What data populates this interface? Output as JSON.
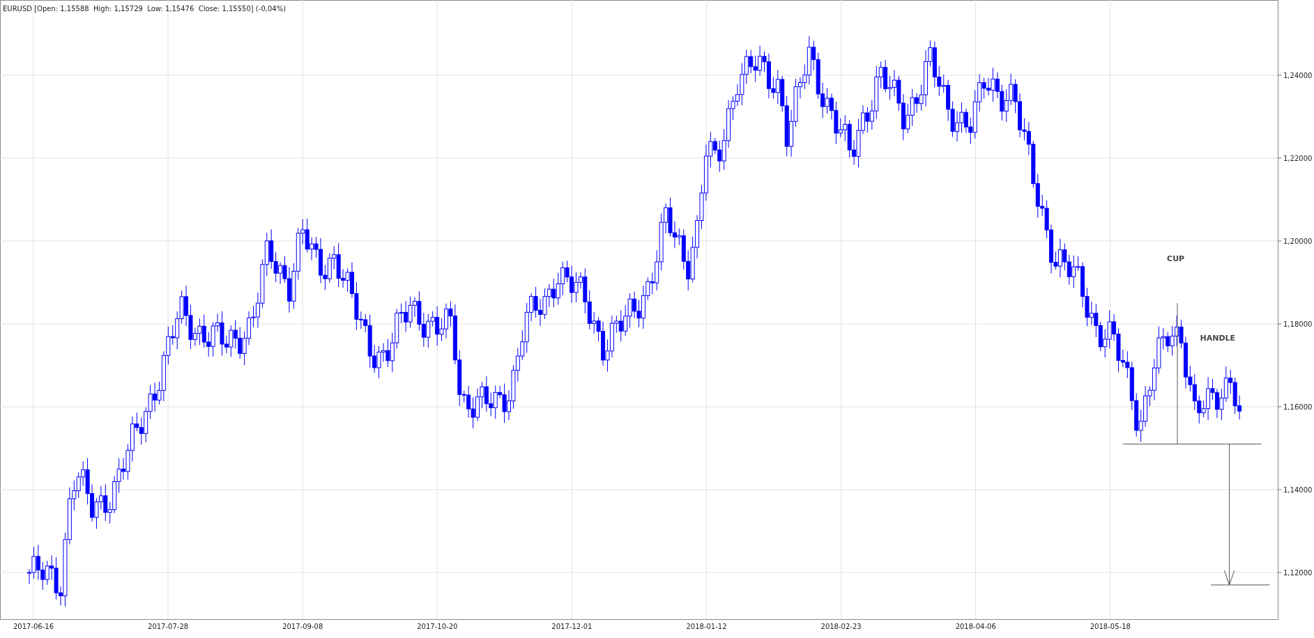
{
  "title": "EURUSD [Open: 1,15588  High: 1,15729  Low: 1,15476  Close: 1,15550] (-0,04%)",
  "y_axis": {
    "ticks": [
      "1,24000",
      "1,22000",
      "1,20000",
      "1,18000",
      "1,16000",
      "1,14000",
      "1,12000"
    ]
  },
  "x_axis": {
    "labels": [
      "2017-06-16",
      "2017-07-28",
      "2017-09-08",
      "2017-10-20",
      "2017-12-01",
      "2018-01-12",
      "2018-02-23",
      "2018-04-06",
      "2018-05-18"
    ]
  },
  "annotations": [
    {
      "kind": "cup",
      "text": "CUP"
    },
    {
      "kind": "handle",
      "text": "HANDLE"
    }
  ]
}
